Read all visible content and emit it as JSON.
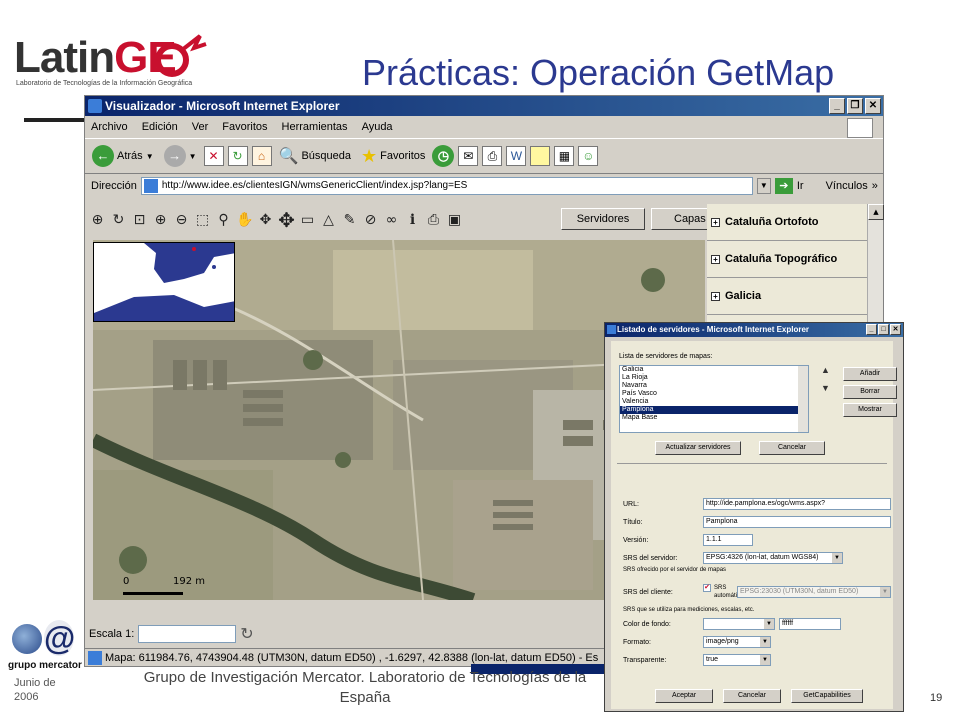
{
  "slide": {
    "logo_main": "Latin",
    "logo_accent": "GE",
    "logo_subtitle": "Laboratorio de Tecnologías de la Información Geográfica",
    "title": "Prácticas: Operación GetMap",
    "footer_date": "Junio de 2006",
    "footer_text": "Grupo de Investigación Mercator. Laboratorio de Tecnologías de la España",
    "page_number": "19",
    "grupo_logo_text": "grupo mercator"
  },
  "browser": {
    "title": "Visualizador - Microsoft Internet Explorer",
    "menu": [
      "Archivo",
      "Edición",
      "Ver",
      "Favoritos",
      "Herramientas",
      "Ayuda"
    ],
    "toolbar": {
      "back": "Atrás",
      "search": "Búsqueda",
      "favorites": "Favoritos"
    },
    "address_label": "Dirección",
    "address_value": "http://www.idee.es/clientesIGN/wmsGenericClient/index.jsp?lang=ES",
    "go_label": "Ir",
    "links_label": "Vínculos",
    "links_more": "»"
  },
  "viewer": {
    "servers_button": "Servidores",
    "layers_button": "Capas",
    "layers": [
      "Cataluña Ortofoto",
      "Cataluña Topográfico",
      "Galicia"
    ],
    "scale_zero": "0",
    "scale_value": "192 m",
    "scale_label": "Escala 1:",
    "status": "Mapa: 611984.76, 4743904.48 (UTM30N, datum ED50) , -1.6297, 42.8388 (lon-lat, datum ED50) - Es"
  },
  "dialog": {
    "title": "Listado de servidores - Microsoft Internet Explorer",
    "list_label": "Lista de servidores de mapas:",
    "servers": [
      "Galicia",
      "La Rioja",
      "Navarra",
      "País Vasco",
      "Valencia",
      "Pamplona",
      "Mapa Base"
    ],
    "selected_server": "Pamplona",
    "btn_add": "Añadir",
    "btn_delete": "Borrar",
    "btn_show": "Mostrar",
    "btn_update": "Actualizar servidores",
    "btn_cancel_top": "Cancelar",
    "url_label": "URL:",
    "url_value": "http://ide.pamplona.es/ogc/wms.aspx?",
    "title_label": "Título:",
    "title_value": "Pamplona",
    "version_label": "Versión:",
    "version_value": "1.1.1",
    "srs_server_label": "SRS del servidor:",
    "srs_server_value": "EPSG:4326 (lon-lat, datum WGS84)",
    "srs_server_note": "SRS ofrecido por el servidor de mapas",
    "srs_client_label": "SRS del cliente:",
    "srs_auto_label": "SRS automático",
    "srs_client_value": "EPSG:23030 (UTM30N, datum ED50)",
    "srs_client_note": "SRS que se utiliza para mediciones, escalas, etc.",
    "bg_color_label": "Color de fondo:",
    "bg_color_value": "ffffff",
    "format_label": "Formato:",
    "format_value": "image/png",
    "transparent_label": "Transparente:",
    "transparent_value": "true",
    "btn_accept": "Aceptar",
    "btn_cancel": "Cancelar",
    "btn_getcap": "GetCapabilities"
  },
  "colors": {
    "title": "#2b3990",
    "accent": "#c8102e",
    "titlebar": "#0a246a"
  }
}
